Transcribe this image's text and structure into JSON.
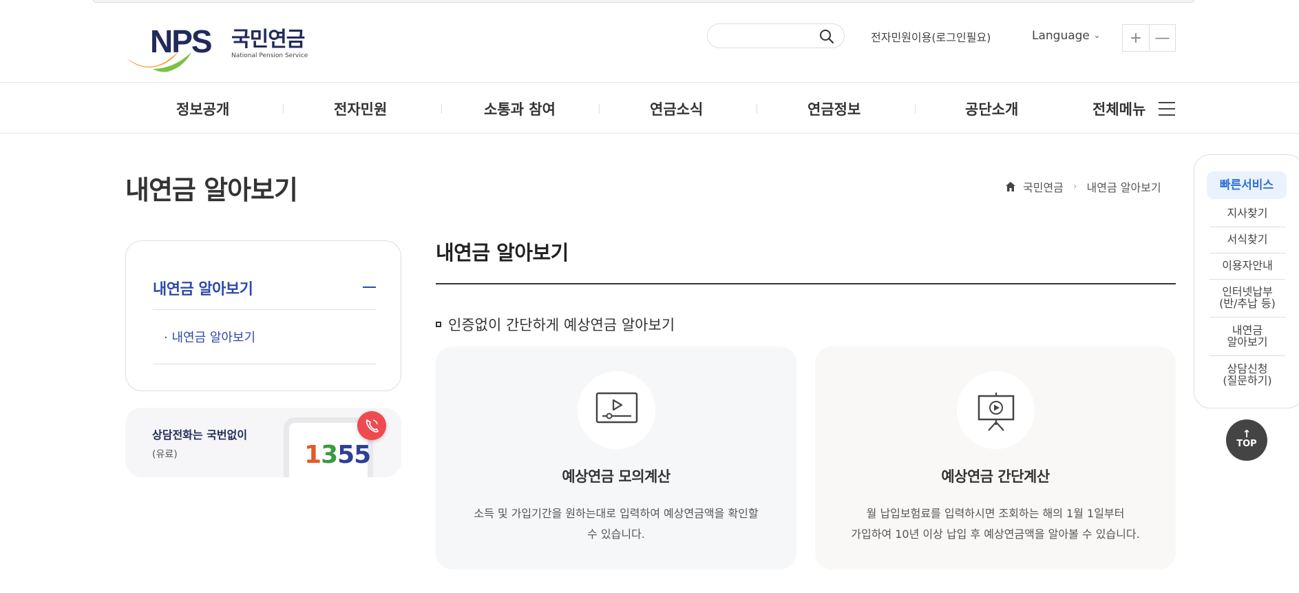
{
  "header": {
    "logo_text_ko": "국민연금",
    "logo_text_en": "National Pension Service",
    "search_placeholder": "",
    "ecivil_label": "전자민원이용(로그인필요)",
    "language_label": "Language",
    "zoom_in": "+",
    "zoom_out": "—"
  },
  "gnb": {
    "items": [
      {
        "label": "정보공개"
      },
      {
        "label": "전자민원"
      },
      {
        "label": "소통과 참여"
      },
      {
        "label": "연금소식"
      },
      {
        "label": "연금정보"
      },
      {
        "label": "공단소개"
      }
    ],
    "all_menu": "전체메뉴"
  },
  "page": {
    "title": "내연금 알아보기",
    "breadcrumb": [
      "국민연금",
      "내연금 알아보기"
    ]
  },
  "lnb": {
    "title": "내연금 알아보기",
    "sub_item": "내연금 알아보기"
  },
  "call_banner": {
    "title": "상담전화는 국번없이",
    "sub": "(유료)",
    "digits": [
      "1",
      "3",
      "55"
    ]
  },
  "content": {
    "title": "내연금 알아보기",
    "section_title": "인증없이 간단하게 예상연금 알아보기",
    "cards": [
      {
        "title": "예상연금 모의계산",
        "desc_line1": "소득 및 가입기간을 원하는대로 입력하여 예상연금액을 확인할",
        "desc_line2": "수 있습니다."
      },
      {
        "title": "예상연금 간단계산",
        "desc_line1": "월 납입보험료를 입력하시면 조회하는 해의 1월 1일부터",
        "desc_line2": "가입하여 10년 이상 납입 후 예상연금액을 알아볼 수 있습니다."
      }
    ]
  },
  "quick": {
    "title": "빠른서비스",
    "items": [
      {
        "line1": "지사찾기",
        "line2": ""
      },
      {
        "line1": "서식찾기",
        "line2": ""
      },
      {
        "line1": "이용자안내",
        "line2": ""
      },
      {
        "line1": "인터넷납부",
        "line2": "(반/추납 등)"
      },
      {
        "line1": "내연금",
        "line2": "알아보기"
      },
      {
        "line1": "상담신청",
        "line2": "(질문하기)"
      }
    ]
  },
  "top_button": "TOP",
  "colors": {
    "brand_navy": "#222a5a",
    "accent_blue": "#2b4aa8",
    "quick_blue": "#2f6fd6",
    "call_red": "#ef4a4f"
  }
}
